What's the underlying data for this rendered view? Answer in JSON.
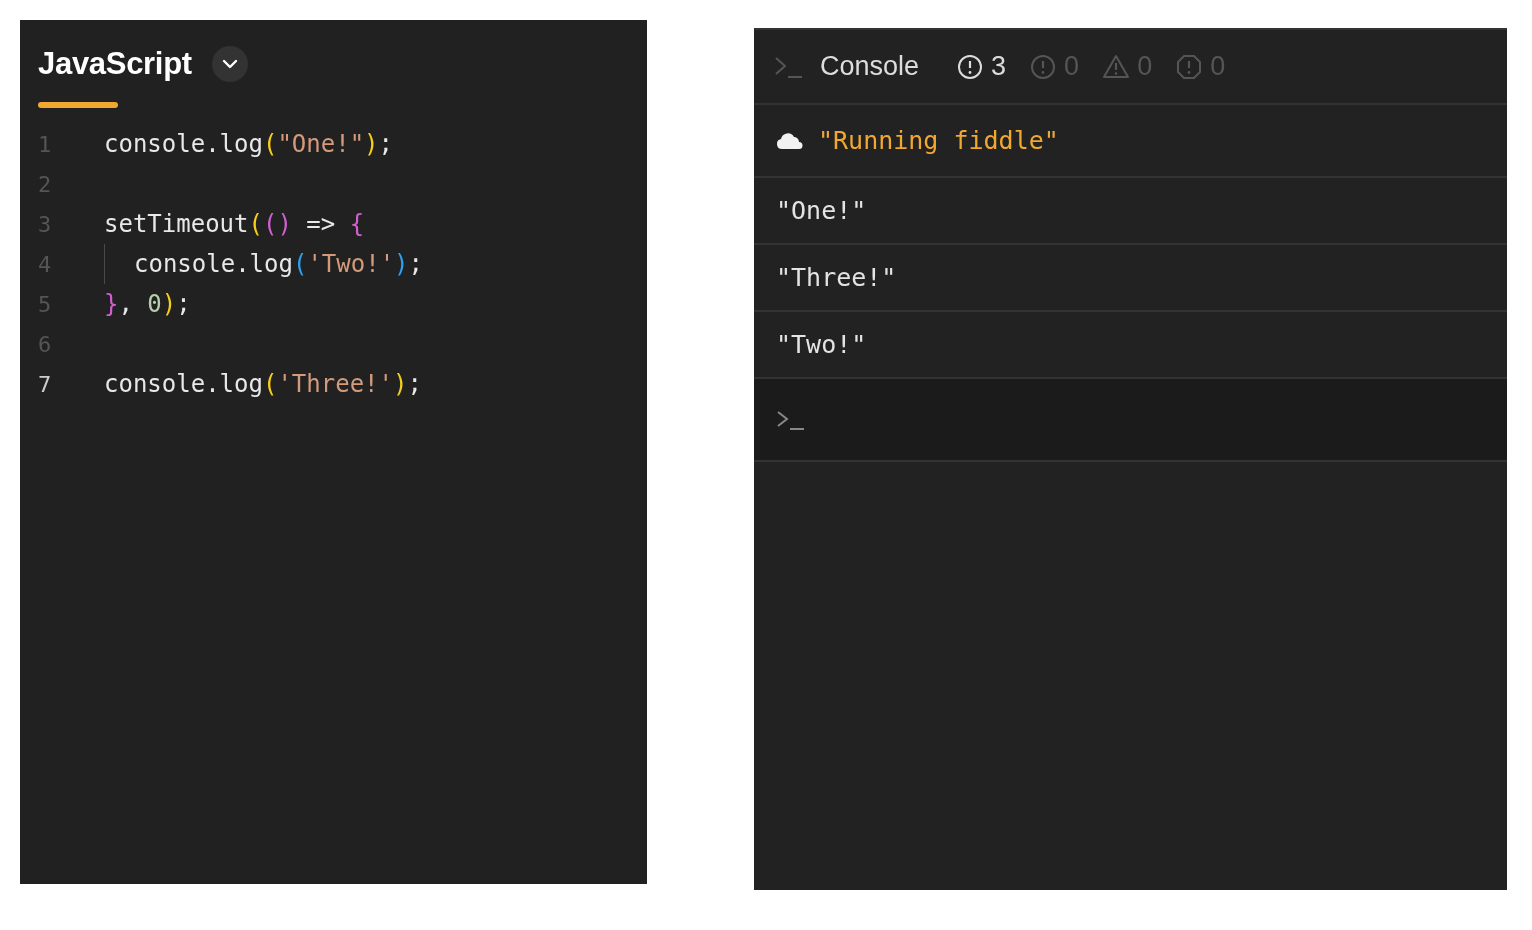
{
  "editor": {
    "language": "JavaScript",
    "lines": [
      {
        "number": "1",
        "active": false,
        "indented": false,
        "tokens": [
          {
            "kind": "plain",
            "text": "console.log"
          },
          {
            "kind": "paren1",
            "text": "("
          },
          {
            "kind": "string",
            "text": "\"One!\""
          },
          {
            "kind": "paren1",
            "text": ")"
          },
          {
            "kind": "plain",
            "text": ";"
          }
        ]
      },
      {
        "number": "2",
        "active": false,
        "indented": false
      },
      {
        "number": "3",
        "active": false,
        "indented": false,
        "tokens": [
          {
            "kind": "plain",
            "text": "setTimeout"
          },
          {
            "kind": "paren1",
            "text": "("
          },
          {
            "kind": "paren2",
            "text": "()"
          },
          {
            "kind": "plain",
            "text": " => "
          },
          {
            "kind": "paren2",
            "text": "{"
          }
        ]
      },
      {
        "number": "4",
        "active": false,
        "indented": true,
        "tokens": [
          {
            "kind": "plain",
            "text": "console.log"
          },
          {
            "kind": "paren3",
            "text": "("
          },
          {
            "kind": "string",
            "text": "'Two!'"
          },
          {
            "kind": "paren3",
            "text": ")"
          },
          {
            "kind": "plain",
            "text": ";"
          }
        ]
      },
      {
        "number": "5",
        "active": false,
        "indented": false,
        "tokens": [
          {
            "kind": "paren2",
            "text": "}"
          },
          {
            "kind": "plain",
            "text": ", "
          },
          {
            "kind": "number",
            "text": "0"
          },
          {
            "kind": "paren1",
            "text": ")"
          },
          {
            "kind": "plain",
            "text": ";"
          }
        ]
      },
      {
        "number": "6",
        "active": false,
        "indented": false
      },
      {
        "number": "7",
        "active": true,
        "indented": false,
        "tokens": [
          {
            "kind": "plain",
            "text": "console.log"
          },
          {
            "kind": "paren1",
            "text": "("
          },
          {
            "kind": "string",
            "text": "'Three!'"
          },
          {
            "kind": "paren1",
            "text": ")"
          },
          {
            "kind": "plain",
            "text": ";"
          }
        ]
      }
    ]
  },
  "console": {
    "title": "Console",
    "filters": [
      {
        "kind": "log",
        "count": "3",
        "active": true
      },
      {
        "kind": "info",
        "count": "0",
        "active": false
      },
      {
        "kind": "warning",
        "count": "0",
        "active": false
      },
      {
        "kind": "error",
        "count": "0",
        "active": false
      }
    ],
    "entries": [
      {
        "kind": "system",
        "text": "\"Running fiddle\""
      },
      {
        "kind": "log",
        "text": "\"One!\""
      },
      {
        "kind": "log",
        "text": "\"Three!\""
      },
      {
        "kind": "log",
        "text": "\"Two!\""
      }
    ]
  }
}
